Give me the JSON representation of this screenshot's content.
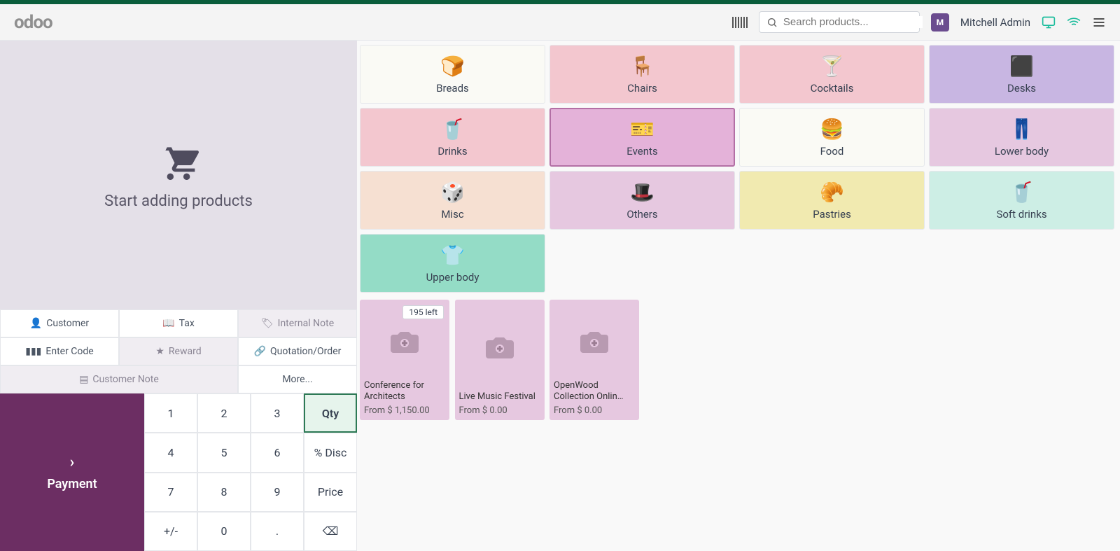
{
  "header": {
    "logo_text": "odoo",
    "search_placeholder": "Search products...",
    "user_name": "Mitchell Admin"
  },
  "cart": {
    "empty_message": "Start adding products"
  },
  "actions": {
    "customer": "Customer",
    "tax": "Tax",
    "internal_note": "Internal Note",
    "enter_code": "Enter Code",
    "reward": "Reward",
    "quotation": "Quotation/Order",
    "customer_note": "Customer Note",
    "more": "More..."
  },
  "numpad": {
    "keys": [
      "1",
      "2",
      "3",
      "Qty",
      "4",
      "5",
      "6",
      "% Disc",
      "7",
      "8",
      "9",
      "Price",
      "+/-",
      "0",
      ".",
      "⌫"
    ],
    "selected": "Qty"
  },
  "payment_label": "Payment",
  "categories": [
    {
      "name": "Breads",
      "icon": "🍞",
      "color": "c-gray"
    },
    {
      "name": "Chairs",
      "icon": "🪑",
      "color": "c-pink"
    },
    {
      "name": "Cocktails",
      "icon": "🍸",
      "color": "c-pink"
    },
    {
      "name": "Desks",
      "icon": "⬛",
      "color": "c-violet"
    },
    {
      "name": "Drinks",
      "icon": "🥤",
      "color": "c-pink"
    },
    {
      "name": "Events",
      "icon": "🎫",
      "color": "c-plum"
    },
    {
      "name": "Food",
      "icon": "🍔",
      "color": "c-gray"
    },
    {
      "name": "Lower body",
      "icon": "👖",
      "color": "c-lav"
    },
    {
      "name": "Misc",
      "icon": "🎲",
      "color": "c-orange"
    },
    {
      "name": "Others",
      "icon": "🎩",
      "color": "c-lav"
    },
    {
      "name": "Pastries",
      "icon": "🥐",
      "color": "c-yellow"
    },
    {
      "name": "Soft drinks",
      "icon": "🥤",
      "color": "c-green"
    },
    {
      "name": "Upper body",
      "icon": "👕",
      "color": "c-teal"
    }
  ],
  "products": [
    {
      "name": "Conference for Architects",
      "price": "From $ 1,150.00",
      "badge": "195 left"
    },
    {
      "name": "Live Music Festival",
      "price": "From $ 0.00"
    },
    {
      "name": "OpenWood Collection Onlin…",
      "price": "From $ 0.00"
    }
  ]
}
